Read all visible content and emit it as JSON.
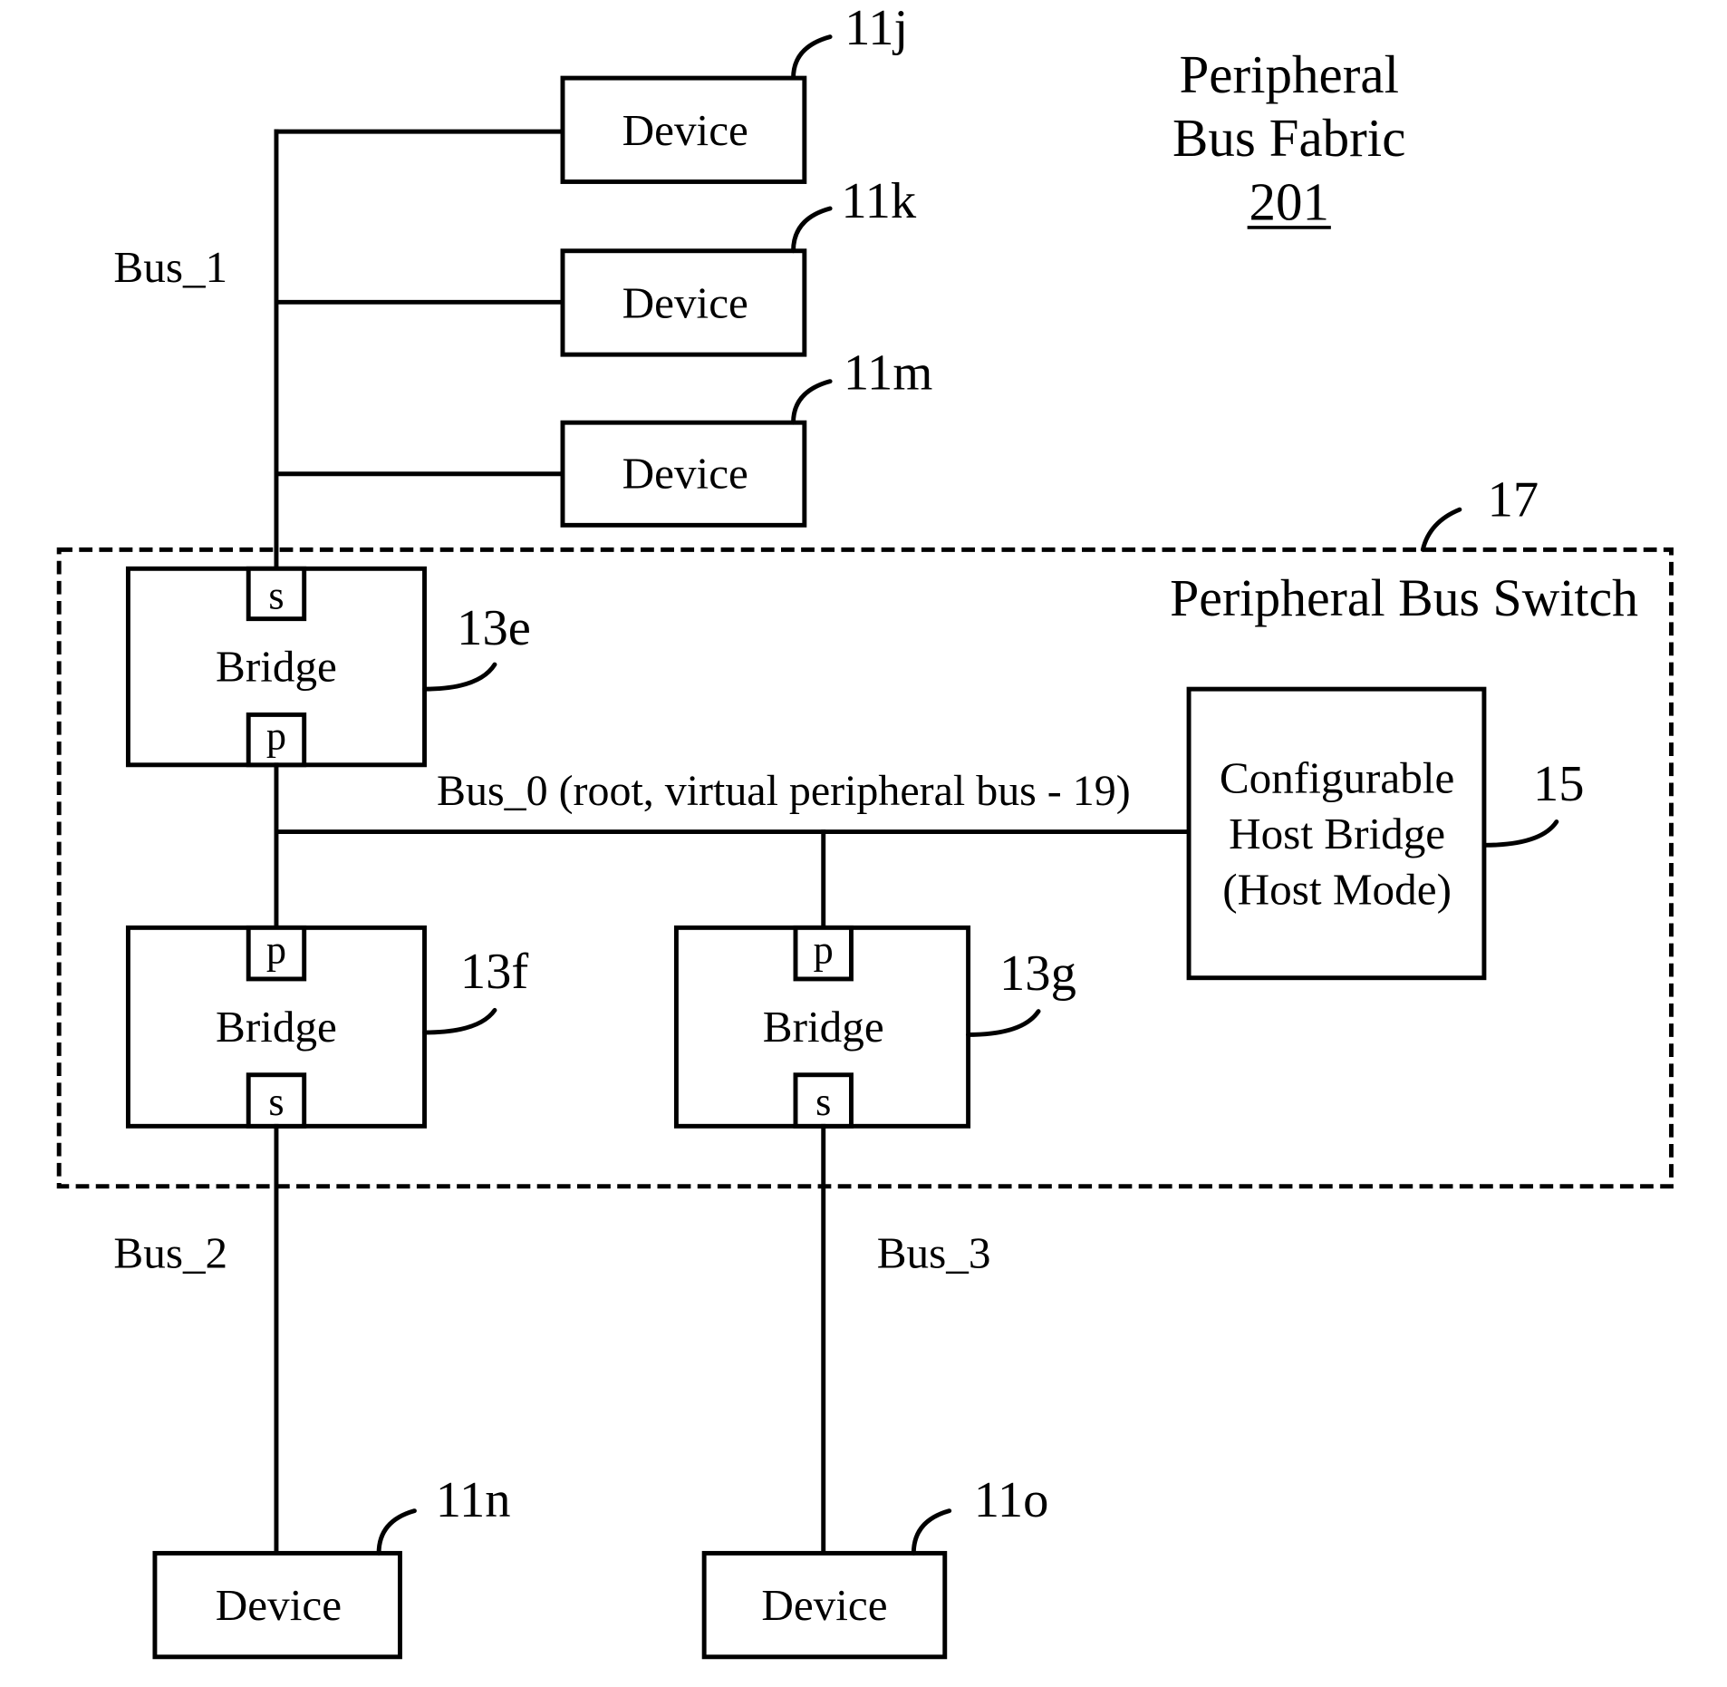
{
  "title": {
    "line1": "Peripheral",
    "line2": "Bus Fabric",
    "ref": "201"
  },
  "switch": {
    "label": "Peripheral Bus Switch",
    "ref": "17"
  },
  "buses": {
    "bus1": "Bus_1",
    "bus0": "Bus_0 (root, virtual peripheral bus - 19)",
    "bus2": "Bus_2",
    "bus3": "Bus_3"
  },
  "devices": [
    {
      "label": "Device",
      "ref": "11j"
    },
    {
      "label": "Device",
      "ref": "11k"
    },
    {
      "label": "Device",
      "ref": "11m"
    },
    {
      "label": "Device",
      "ref": "11n"
    },
    {
      "label": "Device",
      "ref": "11o"
    }
  ],
  "bridges": [
    {
      "label": "Bridge",
      "ref": "13e",
      "upper_port": "s",
      "lower_port": "p"
    },
    {
      "label": "Bridge",
      "ref": "13f",
      "upper_port": "p",
      "lower_port": "s"
    },
    {
      "label": "Bridge",
      "ref": "13g",
      "upper_port": "p",
      "lower_port": "s"
    }
  ],
  "host_bridge": {
    "lines": [
      "Configurable",
      "Host Bridge",
      "(Host Mode)"
    ],
    "ref": "15"
  }
}
